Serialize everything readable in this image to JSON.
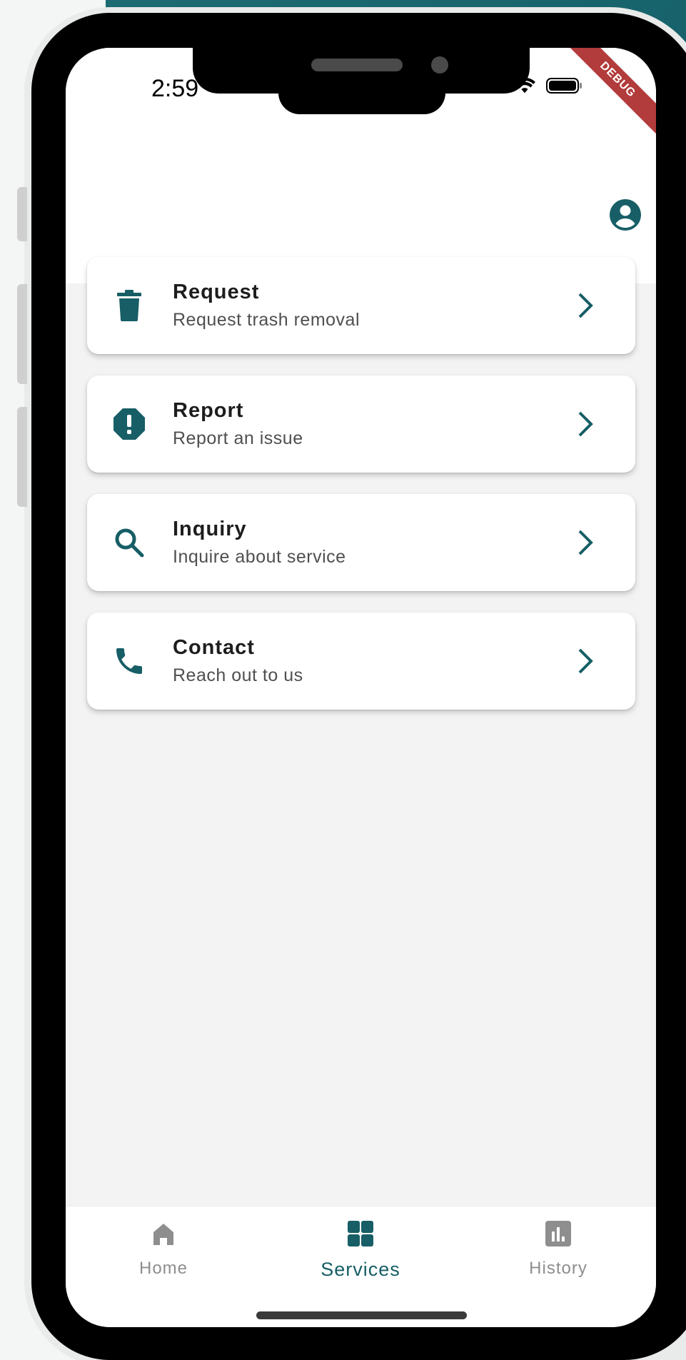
{
  "status_bar": {
    "time": "2:59",
    "debug_label": "DEBUG"
  },
  "services": [
    {
      "title": "Request",
      "subtitle": "Request trash removal",
      "icon": "trash-icon"
    },
    {
      "title": "Report",
      "subtitle": "Report an issue",
      "icon": "alert-octagon-icon"
    },
    {
      "title": "Inquiry",
      "subtitle": "Inquire about service",
      "icon": "search-icon"
    },
    {
      "title": "Contact",
      "subtitle": "Reach out to us",
      "icon": "phone-icon"
    }
  ],
  "bottom_nav": {
    "items": [
      {
        "label": "Home",
        "icon": "home-icon",
        "active": false
      },
      {
        "label": "Services",
        "icon": "grid-icon",
        "active": true
      },
      {
        "label": "History",
        "icon": "bar-chart-icon",
        "active": false
      }
    ]
  },
  "colors": {
    "accent": "#175e66",
    "inactive": "#8e8e8e",
    "background": "#f3f3f3"
  }
}
